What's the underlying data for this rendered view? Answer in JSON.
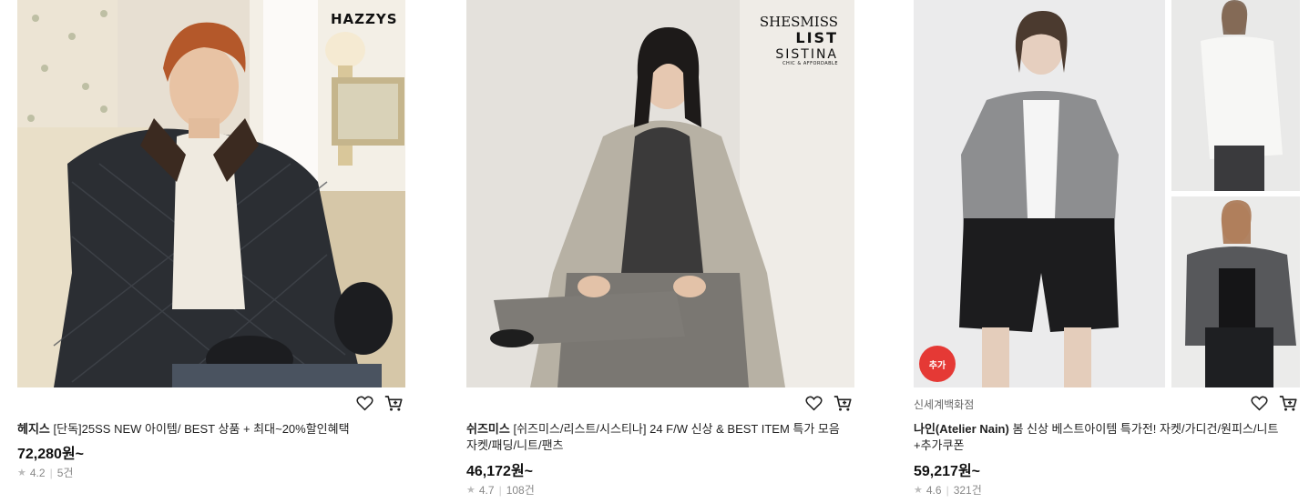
{
  "products": [
    {
      "brand_logo": "HAZZYS",
      "brand": "헤지스",
      "title": "[단독]25SS NEW 아이템/ BEST 상품 + 최대~20%할인혜택",
      "price": "72,280원~",
      "rating": "4.2",
      "reviews": "5건"
    },
    {
      "brand_logo_lines": [
        "SHESMISS",
        "LIST",
        "SISTINA",
        "CHIC & AFFORDABLE"
      ],
      "brand": "쉬즈미스",
      "title": "[쉬즈미스/리스트/시스티나] 24 F/W 신상 & BEST ITEM 특가 모음 자켓/패딩/니트/팬츠",
      "price": "46,172원~",
      "rating": "4.7",
      "reviews": "108건"
    },
    {
      "store": "신세계백화점",
      "badge": "추가",
      "brand": "나인(Atelier Nain)",
      "title": "봄 신상 베스트아이템 특가전! 자켓/가디건/원피스/니트+추가쿠폰",
      "price": "59,217원~",
      "rating": "4.6",
      "reviews": "321건"
    }
  ],
  "icons": {
    "wishlist": "heart-outline-icon",
    "cart": "shopping-cart-icon",
    "rating": "star-icon"
  }
}
